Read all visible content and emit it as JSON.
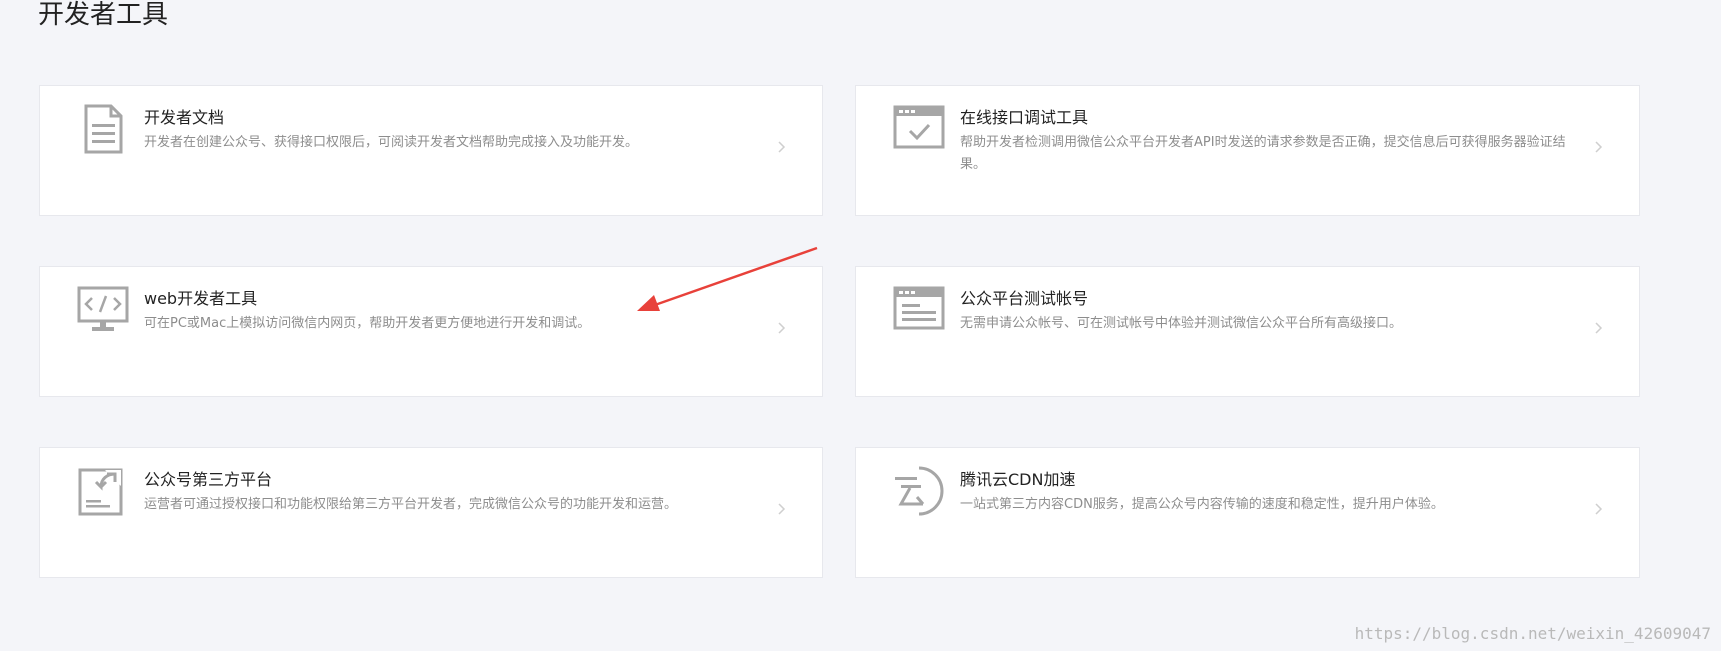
{
  "page": {
    "title": "开发者工具"
  },
  "cards": [
    {
      "title": "开发者文档",
      "desc": "开发者在创建公众号、获得接口权限后，可阅读开发者文档帮助完成接入及功能开发。",
      "icon": "document-icon"
    },
    {
      "title": "在线接口调试工具",
      "desc": "帮助开发者检测调用微信公众平台开发者API时发送的请求参数是否正确，提交信息后可获得服务器验证结果。",
      "icon": "window-check-icon"
    },
    {
      "title": "web开发者工具",
      "desc": "可在PC或Mac上模拟访问微信内网页，帮助开发者更方便地进行开发和调试。",
      "icon": "code-monitor-icon"
    },
    {
      "title": "公众平台测试帐号",
      "desc": "无需申请公众帐号、可在测试帐号中体验并测试微信公众平台所有高级接口。",
      "icon": "test-window-icon"
    },
    {
      "title": "公众号第三方平台",
      "desc": "运营者可通过授权接口和功能权限给第三方平台开发者，完成微信公众号的功能开发和运营。",
      "icon": "third-party-doc-icon"
    },
    {
      "title": "腾讯云CDN加速",
      "desc": "一站式第三方内容CDN服务，提高公众号内容传输的速度和稳定性，提升用户体验。",
      "icon": "cloud-cdn-icon"
    }
  ],
  "watermark": "https://blog.csdn.net/weixin_42609047",
  "colors": {
    "background": "#f4f5f9",
    "card": "#ffffff",
    "icon": "#a6a6a6",
    "annotation_arrow": "#e8413a"
  }
}
